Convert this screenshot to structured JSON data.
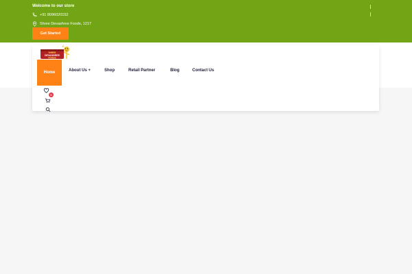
{
  "topbar": {
    "welcome": "Welcome to our store",
    "phone": "+91 8096020152",
    "address": "Shree Devashree Foods, 1217",
    "cta_label": "Get Started"
  },
  "brand": {
    "logo_text_top": "SHREE",
    "logo_text_mid": "DEVASHREE",
    "logo_text_bottom": "FOODS"
  },
  "nav": {
    "items": [
      {
        "label": "Home"
      },
      {
        "label": "About Us +"
      },
      {
        "label": "Shop"
      },
      {
        "label": "Retail Partner"
      },
      {
        "label": "Blog"
      },
      {
        "label": "Contact Us"
      }
    ]
  },
  "utilities": {
    "cart_count": "0"
  },
  "colors": {
    "topbar_green": "#71a516",
    "accent_orange": "#ff8217",
    "nav_text": "#1b1b35",
    "badge_red": "#e63946"
  },
  "icons": [
    "phone-icon",
    "location-pin-icon",
    "heart-icon",
    "cart-icon",
    "search-icon"
  ]
}
